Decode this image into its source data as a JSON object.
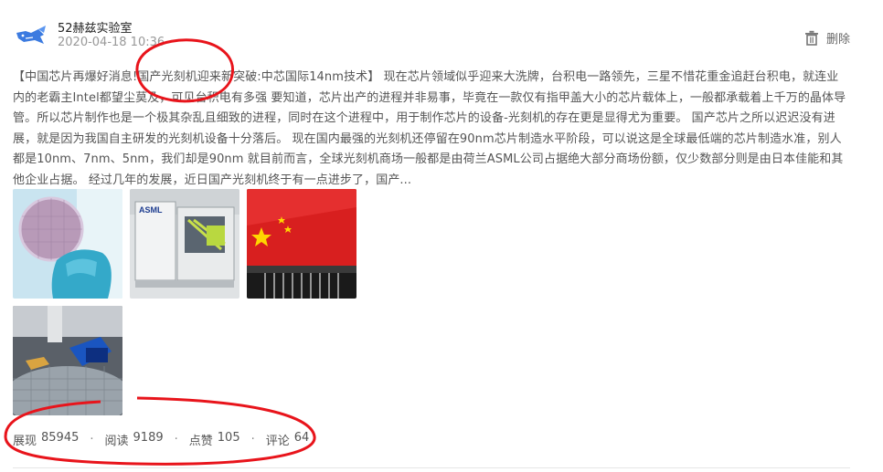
{
  "post": {
    "author": "52赫兹实验室",
    "datetime": "2020-04-18 10:36",
    "delete_label": "删除",
    "body": "【中国芯片再爆好消息!国产光刻机迎来新突破:中芯国际14nm技术】 现在芯片领域似乎迎来大洗牌，台积电一路领先，三星不惜花重金追赶台积电，就连业内的老霸主Intel都望尘莫及，可见台积电有多强 要知道，芯片出产的进程并非易事，毕竟在一款仅有指甲盖大小的芯片载体上，一般都承载着上千万的晶体导管。所以芯片制作也是一个极其杂乱且细致的进程，同时在这个进程中，用于制作芯片的设备-光刻机的存在更是显得尤为重要。 国产芯片之所以迟迟没有进展，就是因为我国自主研发的光刻机设备十分落后。 现在国内最强的光刻机还停留在90nm芯片制造水平阶段，可以说这是全球最低端的芯片制造水准，别人都是10nm、7nm、5nm，我们却是90nm 就目前而言，全球光刻机商场一般都是由荷兰ASML公司占据绝大部分商场份额，仅少数部分则是由日本佳能和其他企业占据。 经过几年的发展，近日国产光刻机终于有一点进步了，国产...",
    "thumb_labels": {
      "machine_brand": "ASML"
    },
    "stats": [
      {
        "label": "展现",
        "value": "85945"
      },
      {
        "label": "阅读",
        "value": "9189"
      },
      {
        "label": "点赞",
        "value": "105"
      },
      {
        "label": "评论",
        "value": "64"
      }
    ],
    "separator": "·"
  },
  "icons": {
    "avatar": "whale-logo-icon",
    "delete": "trash-icon"
  },
  "colors": {
    "annotation_red": "#e8141b",
    "avatar_blue": "#3c7be0",
    "muted_text": "#999999",
    "body_text": "#555555"
  }
}
